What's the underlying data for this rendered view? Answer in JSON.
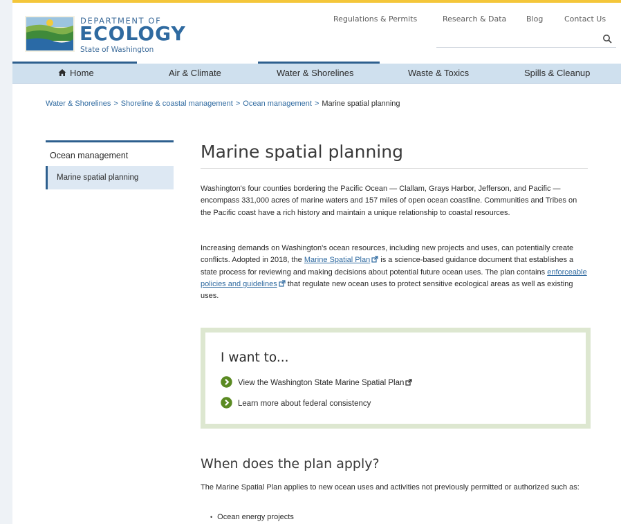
{
  "header": {
    "logo": {
      "line1": "DEPARTMENT OF",
      "line2": "ECOLOGY",
      "line3": "State of Washington"
    },
    "utility_links": [
      "Regulations & Permits",
      "Research & Data",
      "Blog",
      "Contact Us"
    ],
    "search_placeholder": ""
  },
  "nav": {
    "items": [
      "Home",
      "Air & Climate",
      "Water & Shorelines",
      "Waste & Toxics",
      "Spills & Cleanup"
    ],
    "active": "Water & Shorelines"
  },
  "breadcrumb": {
    "links": [
      "Water & Shorelines",
      "Shoreline & coastal management",
      "Ocean management"
    ],
    "current": "Marine spatial planning"
  },
  "sidebar": {
    "parent": "Ocean management",
    "current": "Marine spatial planning"
  },
  "main": {
    "title": "Marine spatial planning",
    "p1": "Washington's four counties bordering the Pacific Ocean — Clallam, Grays Harbor, Jefferson, and Pacific — encompass 331,000 acres of marine waters and 157 miles of open ocean coastline. Communities and Tribes on the Pacific coast have a rich history and maintain a unique relationship to coastal resources.",
    "p2_a": "Increasing demands on Washington's ocean resources, including new projects and uses, can potentially create conflicts. Adopted in 2018, the ",
    "p2_link1": "Marine Spatial Plan",
    "p2_b": " is a science-based guidance document that establishes a state process for reviewing and making decisions about potential future ocean uses. The plan contains ",
    "p2_link2": "enforceable policies and guidelines",
    "p2_c": " that regulate new ocean uses to protect sensitive ecological areas as well as existing uses.",
    "want": {
      "title": "I want to...",
      "links": [
        "View the Washington State Marine Spatial Plan",
        "Learn more about federal consistency"
      ]
    },
    "h2": "When does the plan apply?",
    "p3": "The Marine Spatial Plan applies to new ocean uses and activities not previously permitted or authorized such as:",
    "bullets": [
      "Ocean energy projects"
    ]
  },
  "colors": {
    "accent": "#2d5f8e",
    "nav_bg": "#cfe0ee",
    "link": "#2f6aa0",
    "box_border": "#dde7d0",
    "icon_green": "#5a8a22",
    "top_bar": "#f4c63a"
  },
  "icons": {
    "search": "search-icon",
    "home": "home-icon",
    "external": "external-link-icon",
    "arrow": "arrow-circle-icon"
  }
}
